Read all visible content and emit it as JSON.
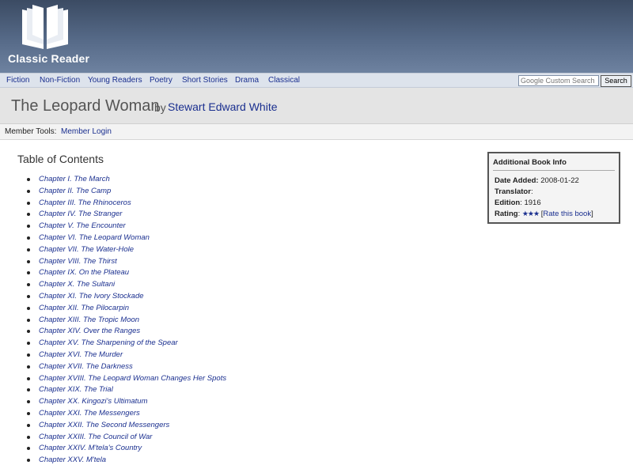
{
  "header": {
    "logo_icon": "open-book-icon",
    "site_name": "Classic Reader",
    "colors": {
      "header_bg": "#566a88",
      "link": "#1a2f8f"
    }
  },
  "nav": {
    "items": [
      {
        "label": "Fiction"
      },
      {
        "label": "Non-Fiction"
      },
      {
        "label": "Young Readers"
      },
      {
        "label": "Poetry"
      },
      {
        "label": "Short Stories"
      },
      {
        "label": "Drama"
      },
      {
        "label": "Classical"
      }
    ],
    "search_placeholder": "Google Custom Search",
    "search_button": "Search"
  },
  "book": {
    "title": "The Leopard Woman",
    "by": "by",
    "author": "Stewart Edward White"
  },
  "member": {
    "label": "Member Tools:",
    "login": "Member Login"
  },
  "toc": {
    "heading": "Table of Contents",
    "chapters": [
      "Chapter I. The March",
      "Chapter II. The Camp",
      "Chapter III. The Rhinoceros",
      "Chapter IV. The Stranger",
      "Chapter V. The Encounter",
      "Chapter VI. The Leopard Woman",
      "Chapter VII. The Water-Hole",
      "Chapter VIII. The Thirst",
      "Chapter IX. On the Plateau",
      "Chapter X. The Sultani",
      "Chapter XI. The Ivory Stockade",
      "Chapter XII. The Pilocarpin",
      "Chapter XIII. The Tropic Moon",
      "Chapter XIV. Over the Ranges",
      "Chapter XV. The Sharpening of the Spear",
      "Chapter XVI. The Murder",
      "Chapter XVII. The Darkness",
      "Chapter XVIII. The Leopard Woman Changes Her Spots",
      "Chapter XIX. The Trial",
      "Chapter XX. Kingozi's Ultimatum",
      "Chapter XXI. The Messengers",
      "Chapter XXII. The Second Messengers",
      "Chapter XXIII. The Council of War",
      "Chapter XXIV. M'tela's Country",
      "Chapter XXV. M'tela"
    ]
  },
  "info": {
    "title": "Additional Book Info",
    "date_label": "Date Added:",
    "date_value": "2008-01-22",
    "translator_label": "Translator",
    "translator_sep": ":",
    "edition_label": "Edition",
    "edition_value": ": 1916",
    "rating_label": "Rating",
    "rating_sep": ":",
    "rating_stars": "★★★",
    "rating_value": 3,
    "rate_open": "[",
    "rate_link": "Rate this book",
    "rate_close": "]"
  }
}
